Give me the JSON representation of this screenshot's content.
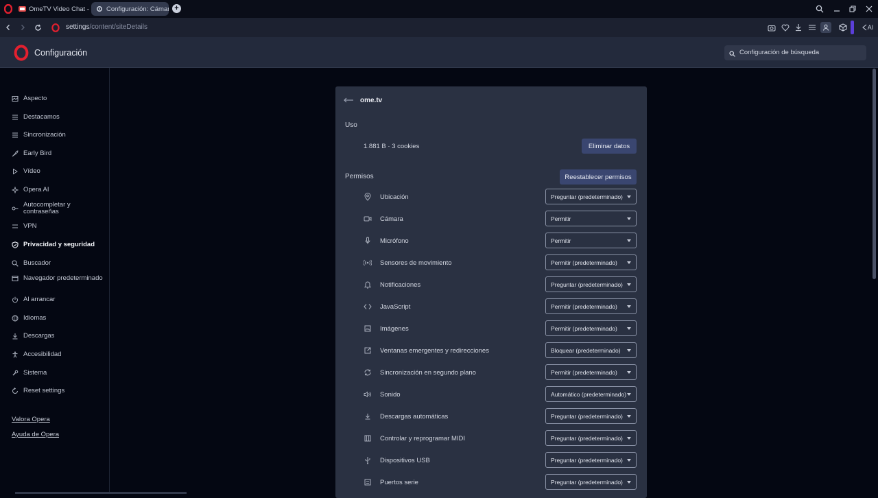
{
  "tabs": [
    {
      "title": "OmeTV Video Chat — Or…"
    },
    {
      "title": "Configuración: Cámara"
    }
  ],
  "address": {
    "host": "settings",
    "path": "/content/siteDetails"
  },
  "toolbar": {
    "ai_label": "AI"
  },
  "header": {
    "title": "Configuración",
    "search_placeholder": "Configuración de búsqueda"
  },
  "sidebar": {
    "items": [
      {
        "label": "Aspecto",
        "icon": "appearance-icon"
      },
      {
        "label": "Destacamos",
        "icon": "list-icon"
      },
      {
        "label": "Sincronización",
        "icon": "sync-list-icon"
      },
      {
        "label": "Early Bird",
        "icon": "bird-icon"
      },
      {
        "label": "Vídeo",
        "icon": "play-icon"
      },
      {
        "label": "Opera AI",
        "icon": "ai-icon"
      },
      {
        "label": "Autocompletar y contraseñas",
        "icon": "key-icon"
      },
      {
        "label": "VPN",
        "icon": "vpn-icon"
      },
      {
        "label": "Privacidad y seguridad",
        "icon": "shield-icon"
      },
      {
        "label": "Buscador",
        "icon": "search-icon"
      },
      {
        "label": "Navegador predeterminado",
        "icon": "browser-icon"
      },
      {
        "label": "Al arrancar",
        "icon": "power-icon"
      },
      {
        "label": "Idiomas",
        "icon": "globe-icon"
      },
      {
        "label": "Descargas",
        "icon": "download-icon"
      },
      {
        "label": "Accesibilidad",
        "icon": "accessibility-icon"
      },
      {
        "label": "Sistema",
        "icon": "wrench-icon"
      },
      {
        "label": "Reset settings",
        "icon": "reset-icon"
      }
    ],
    "links": [
      {
        "label": "Valora Opera"
      },
      {
        "label": "Ayuda de Opera"
      }
    ]
  },
  "site": {
    "name": "ome.tv",
    "usage_title": "Uso",
    "usage_value": "1.881 B · 3 cookies",
    "clear_button": "Eliminar datos",
    "permissions_title": "Permisos",
    "reset_button": "Reestablecer permisos"
  },
  "permissions": [
    {
      "label": "Ubicación",
      "value": "Preguntar (predeterminado)",
      "icon": "location-icon"
    },
    {
      "label": "Cámara",
      "value": "Permitir",
      "icon": "camera-icon"
    },
    {
      "label": "Micrófono",
      "value": "Permitir",
      "icon": "microphone-icon"
    },
    {
      "label": "Sensores de movimiento",
      "value": "Permitir (predeterminado)",
      "icon": "sensors-icon"
    },
    {
      "label": "Notificaciones",
      "value": "Preguntar (predeterminado)",
      "icon": "bell-icon"
    },
    {
      "label": "JavaScript",
      "value": "Permitir (predeterminado)",
      "icon": "code-icon"
    },
    {
      "label": "Imágenes",
      "value": "Permitir (predeterminado)",
      "icon": "image-icon"
    },
    {
      "label": "Ventanas emergentes y redirecciones",
      "value": "Bloquear (predeterminado)",
      "icon": "popup-icon"
    },
    {
      "label": "Sincronización en segundo plano",
      "value": "Permitir (predeterminado)",
      "icon": "sync-icon"
    },
    {
      "label": "Sonido",
      "value": "Automático (predeterminado)",
      "icon": "sound-icon"
    },
    {
      "label": "Descargas automáticas",
      "value": "Preguntar (predeterminado)",
      "icon": "download-icon"
    },
    {
      "label": "Controlar y reprogramar MIDI",
      "value": "Preguntar (predeterminado)",
      "icon": "midi-icon"
    },
    {
      "label": "Dispositivos USB",
      "value": "Preguntar (predeterminado)",
      "icon": "usb-icon"
    },
    {
      "label": "Puertos serie",
      "value": "Preguntar (predeterminado)",
      "icon": "serial-icon"
    }
  ]
}
